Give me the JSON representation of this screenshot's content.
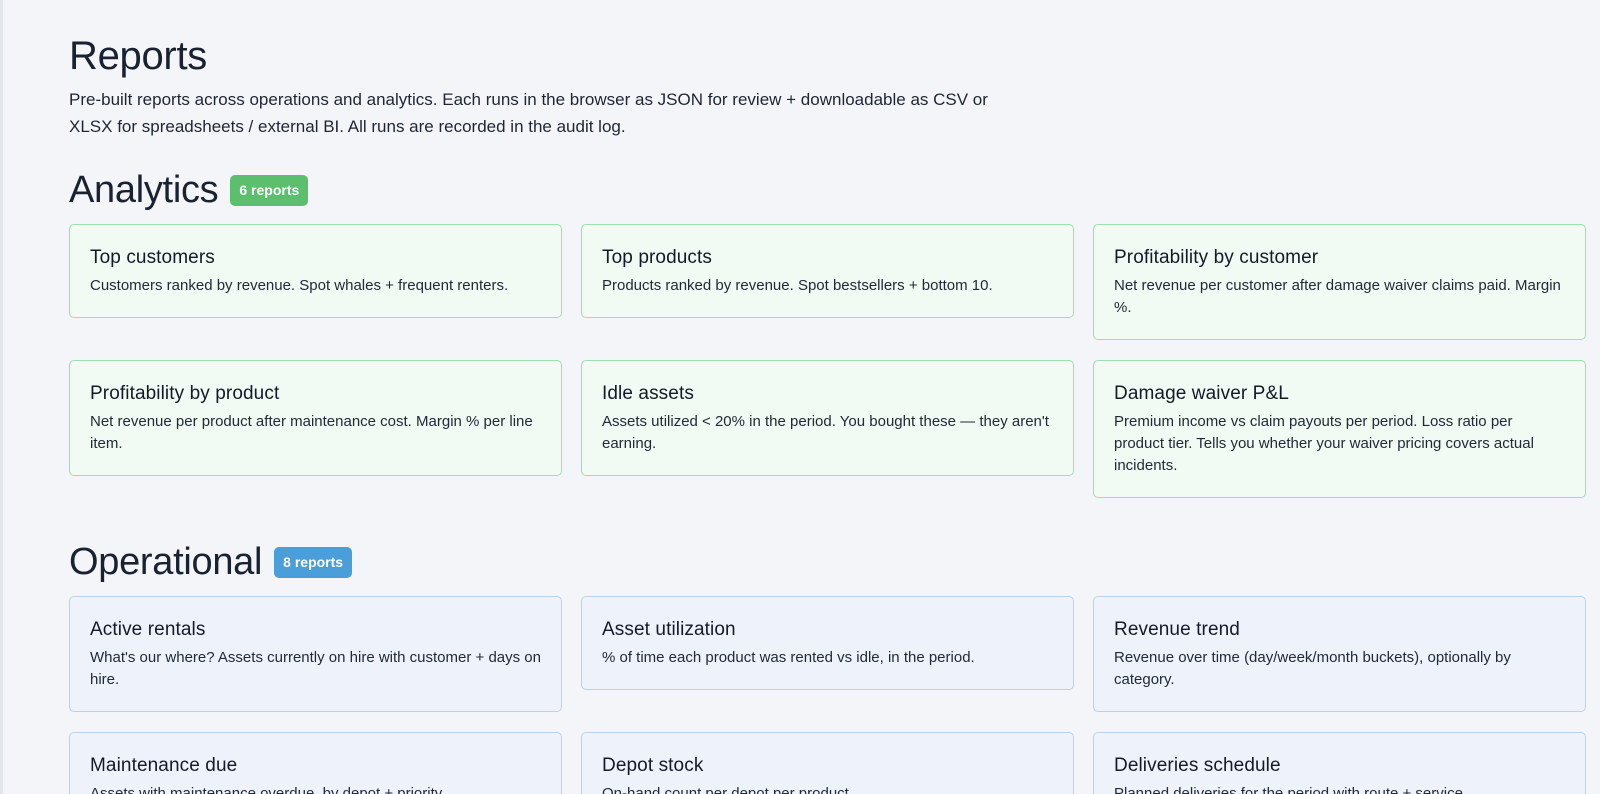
{
  "header": {
    "title": "Reports",
    "description": "Pre-built reports across operations and analytics. Each runs in the browser as JSON for review + downloadable as CSV or XLSX for spreadsheets / external BI. All runs are recorded in the audit log."
  },
  "analytics": {
    "title": "Analytics",
    "badge": "6 reports",
    "badge_color": "#5bbf6e",
    "cards": [
      {
        "title": "Top customers",
        "desc": "Customers ranked by revenue. Spot whales + frequent renters."
      },
      {
        "title": "Top products",
        "desc": "Products ranked by revenue. Spot bestsellers + bottom 10."
      },
      {
        "title": "Profitability by customer",
        "desc": "Net revenue per customer after damage waiver claims paid. Margin %."
      },
      {
        "title": "Profitability by product",
        "desc": "Net revenue per product after maintenance cost. Margin % per line item."
      },
      {
        "title": "Idle assets",
        "desc": "Assets utilized < 20% in the period. You bought these — they aren't earning."
      },
      {
        "title": "Damage waiver P&L",
        "desc": "Premium income vs claim payouts per period. Loss ratio per product tier. Tells you whether your waiver pricing covers actual incidents."
      }
    ]
  },
  "operational": {
    "title": "Operational",
    "badge": "8 reports",
    "badge_color": "#4a9ed9",
    "cards": [
      {
        "title": "Active rentals",
        "desc": "What's our where? Assets currently on hire with customer + days on hire."
      },
      {
        "title": "Asset utilization",
        "desc": "% of time each product was rented vs idle, in the period."
      },
      {
        "title": "Revenue trend",
        "desc": "Revenue over time (day/week/month buckets), optionally by category."
      },
      {
        "title": "Maintenance due",
        "desc": "Assets with maintenance overdue, by depot + priority."
      },
      {
        "title": "Depot stock",
        "desc": "On-hand count per depot per product."
      },
      {
        "title": "Deliveries schedule",
        "desc": "Planned deliveries for the period with route + service"
      }
    ]
  }
}
